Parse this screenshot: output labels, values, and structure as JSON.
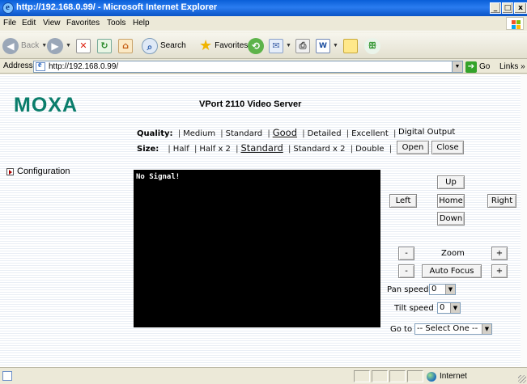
{
  "window": {
    "title": "http://192.168.0.99/ - Microsoft Internet Explorer",
    "minimize": "_",
    "maximize": "□",
    "close": "x"
  },
  "menu": [
    "File",
    "Edit",
    "View",
    "Favorites",
    "Tools",
    "Help"
  ],
  "toolbar": {
    "back": "Back",
    "search": "Search",
    "favorites": "Favorites"
  },
  "address": {
    "label": "Address",
    "url": "http://192.168.0.99/",
    "go": "Go",
    "links": "Links »"
  },
  "page": {
    "logo": "MOXA",
    "title": "VPort 2110 Video Server",
    "quality_label": "Quality:",
    "quality_options": [
      "Medium",
      "Standard",
      "Good",
      "Detailed",
      "Excellent"
    ],
    "quality_selected": "Good",
    "size_label": "Size:",
    "size_options": [
      "Half",
      "Half x 2",
      "Standard",
      "Standard x 2",
      "Double"
    ],
    "size_selected": "Standard",
    "digital_output": "Digital Output",
    "open": "Open",
    "close": "Close",
    "configuration": "Configuration",
    "video_text": "No Signal!",
    "ptz": {
      "up": "Up",
      "left": "Left",
      "home": "Home",
      "right": "Right",
      "down": "Down",
      "zoom": "Zoom",
      "auto_focus": "Auto Focus",
      "minus": "-",
      "plus": "+",
      "pan_speed_label": "Pan speed",
      "pan_speed_value": "0",
      "tilt_speed_label": "Tilt speed",
      "tilt_speed_value": "0",
      "goto_label": "Go to",
      "goto_value": "-- Select One --"
    }
  },
  "status": {
    "zone": "Internet"
  },
  "colors": {
    "moxa_green": "#0a7d6b",
    "titlebar_blue": "#0a5fd8"
  }
}
